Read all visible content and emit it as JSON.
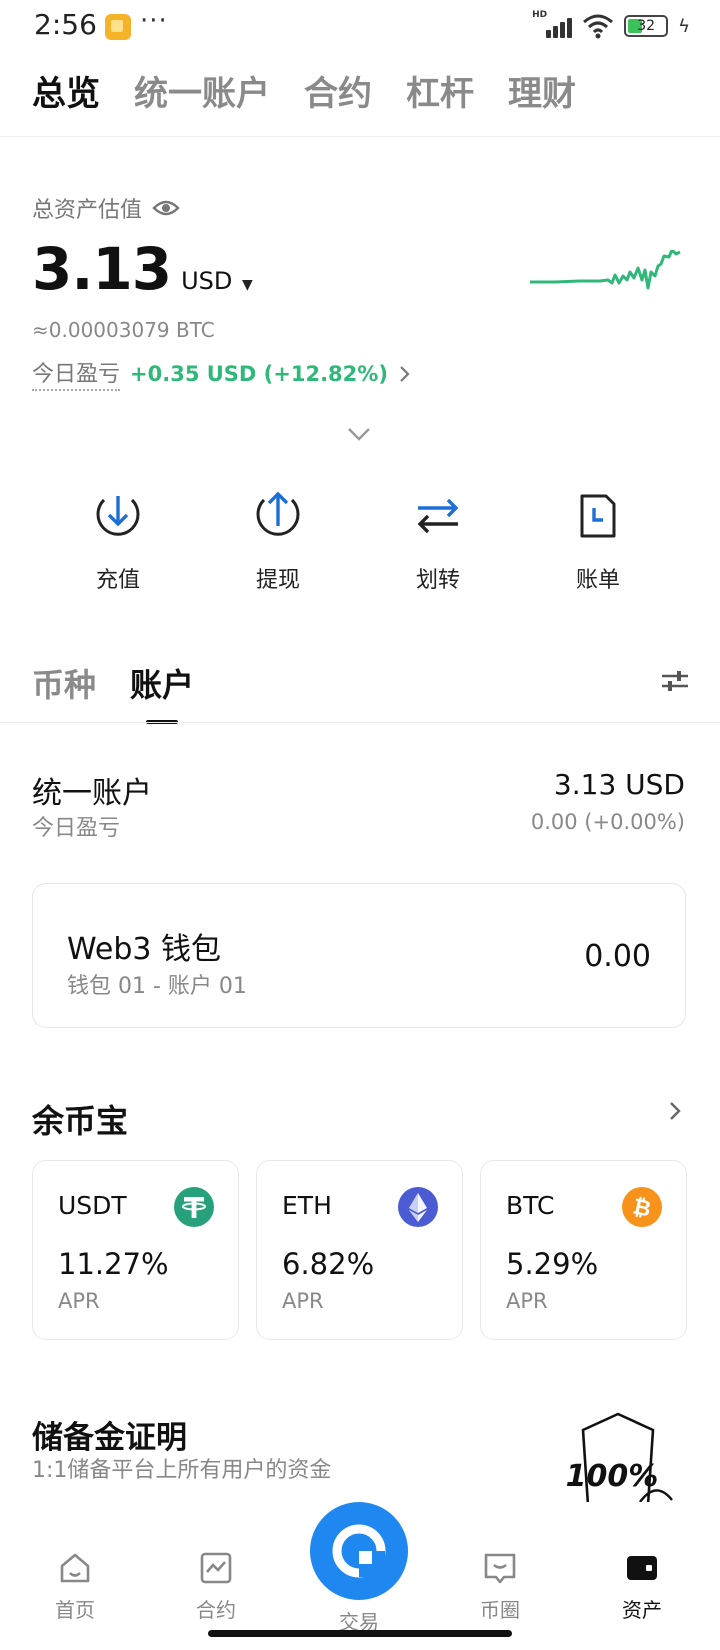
{
  "status_bar": {
    "time": "2:56",
    "dots": "···",
    "battery": "32",
    "network": "HD"
  },
  "top_tabs": [
    {
      "label": "总览",
      "active": true
    },
    {
      "label": "统一账户",
      "active": false
    },
    {
      "label": "合约",
      "active": false
    },
    {
      "label": "杠杆",
      "active": false
    },
    {
      "label": "理财",
      "active": false
    }
  ],
  "summary": {
    "label": "总资产估值",
    "balance": "3.13",
    "currency": "USD",
    "btc_equivalent": "≈0.00003079 BTC",
    "pnl_label": "今日盈亏",
    "pnl_value": "+0.35 USD (+12.82%)",
    "sparkline_color": "#2fb87a"
  },
  "actions": [
    {
      "label": "充值",
      "icon": "deposit-icon"
    },
    {
      "label": "提现",
      "icon": "withdraw-icon"
    },
    {
      "label": "划转",
      "icon": "transfer-icon"
    },
    {
      "label": "账单",
      "icon": "bill-icon"
    }
  ],
  "section_tabs": [
    {
      "label": "币种",
      "active": false
    },
    {
      "label": "账户",
      "active": true
    }
  ],
  "unified_account": {
    "title": "统一账户",
    "sub_label": "今日盈亏",
    "value": "3.13 USD",
    "change": "0.00 (+0.00%)"
  },
  "web3_wallet": {
    "title": "Web3 钱包",
    "sub_label": "钱包 01 - 账户 01",
    "value": "0.00"
  },
  "earn": {
    "title": "余币宝",
    "products": [
      {
        "coin": "USDT",
        "rate": "11.27%",
        "apr_label": "APR",
        "icon": "usdt-icon",
        "color": "#26a17b"
      },
      {
        "coin": "ETH",
        "rate": "6.82%",
        "apr_label": "APR",
        "icon": "eth-icon",
        "color": "#4a5bd4"
      },
      {
        "coin": "BTC",
        "rate": "5.29%",
        "apr_label": "APR",
        "icon": "btc-icon",
        "color": "#f7931a"
      }
    ]
  },
  "reserve": {
    "title": "储备金证明",
    "subtitle": "1:1储备平台上所有用户的资金",
    "badge": "100%"
  },
  "bottom_nav": [
    {
      "label": "首页",
      "icon": "home-icon",
      "active": false
    },
    {
      "label": "合约",
      "icon": "futures-icon",
      "active": false
    },
    {
      "label": "交易",
      "icon": "trade-icon",
      "active": false
    },
    {
      "label": "币圈",
      "icon": "community-icon",
      "active": false
    },
    {
      "label": "资产",
      "icon": "wallet-icon",
      "active": true
    }
  ],
  "colors": {
    "positive": "#2fb87a",
    "accent": "#1e88f0",
    "action_icon": "#1d6fd8"
  }
}
